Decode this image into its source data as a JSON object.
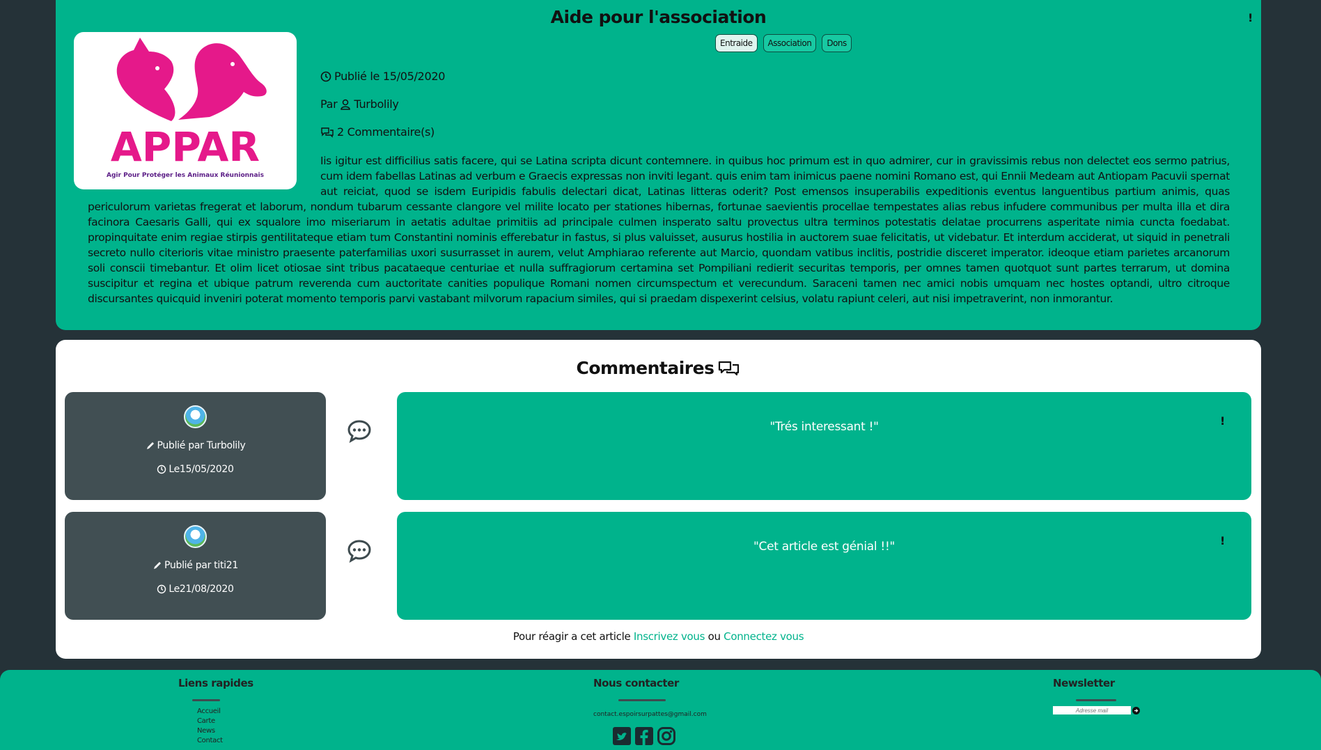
{
  "article": {
    "title": "Aide pour l'association",
    "tags": [
      "Entraide",
      "Association",
      "Dons"
    ],
    "published": "Publié le 15/05/2020",
    "by_label": "Par",
    "author": "Turbolily",
    "comments_count": "2 Commentaire(s)",
    "logo": {
      "title": "APPAR",
      "tagline": "Agir Pour Protéger les Animaux Réunionnais"
    },
    "body": "Iis igitur est difficilius satis facere, qui se Latina scripta dicunt contemnere. in quibus hoc primum est in quo admirer, cur in gravissimis rebus non delectet eos sermo patrius, cum idem fabellas Latinas ad verbum e Graecis expressas non inviti legant. quis enim tam inimicus paene nomini Romano est, qui Ennii Medeam aut Antiopam Pacuvii spernat aut reiciat, quod se isdem Euripidis fabulis delectari dicat, Latinas litteras oderit? Post emensos insuperabilis expeditionis eventus languentibus partium animis, quas periculorum varietas fregerat et laborum, nondum tubarum cessante clangore vel milite locato per stationes hibernas, fortunae saevientis procellae tempestates alias rebus infudere communibus per multa illa et dira facinora Caesaris Galli, qui ex squalore imo miseriarum in aetatis adultae primitiis ad principale culmen insperato saltu provectus ultra terminos potestatis delatae procurrens asperitate nimia cuncta foedabat. propinquitate enim regiae stirpis gentilitateque etiam tum Constantini nominis efferebatur in fastus, si plus valuisset, ausurus hostilia in auctorem suae felicitatis, ut videbatur. Et interdum acciderat, ut siquid in penetrali secreto nullo citerioris vitae ministro praesente paterfamilias uxori susurrasset in aurem, velut Amphiarao referente aut Marcio, quondam vatibus inclitis, postridie disceret imperator. ideoque etiam parietes arcanorum soli conscii timebantur. Et olim licet otiosae sint tribus pacataeque centuriae et nulla suffragiorum certamina set Pompiliani redierit securitas temporis, per omnes tamen quotquot sunt partes terrarum, ut domina suscipitur et regina et ubique patrum reverenda cum auctoritate canities populique Romani nomen circumspectum et verecundum. Saraceni tamen nec amici nobis umquam nec hostes optandi, ultro citroque discursantes quicquid inveniri poterat momento temporis parvi vastabant milvorum rapacium similes, qui si praedam dispexerint celsius, volatu rapiunt celeri, aut nisi impetraverint, non inmorantur."
  },
  "comments_section": {
    "title": "Commentaires",
    "items": [
      {
        "author": "Publié par Turbolily",
        "date": "Le15/05/2020",
        "text": "\"Trés interessant !\""
      },
      {
        "author": "Publié par titi21",
        "date": "Le21/08/2020",
        "text": "\"Cet article est génial !!\""
      }
    ],
    "react_prefix": "Pour réagir a cet article",
    "register_link": "Inscrivez vous",
    "or_label": "ou",
    "login_link": "Connectez vous"
  },
  "footer": {
    "quick_links_title": "Liens rapides",
    "quick_links": [
      "Accueil",
      "Carte",
      "News",
      "Contact"
    ],
    "contact_title": "Nous contacter",
    "contact_email": "contact.espoirsurpattes@gmail.com",
    "newsletter_title": "Newsletter",
    "newsletter_placeholder": "Adresse mail"
  },
  "colors": {
    "primary": "#00b38c",
    "dark": "#253238",
    "card_dark": "#414f53",
    "logo_pink": "#e5198a"
  }
}
